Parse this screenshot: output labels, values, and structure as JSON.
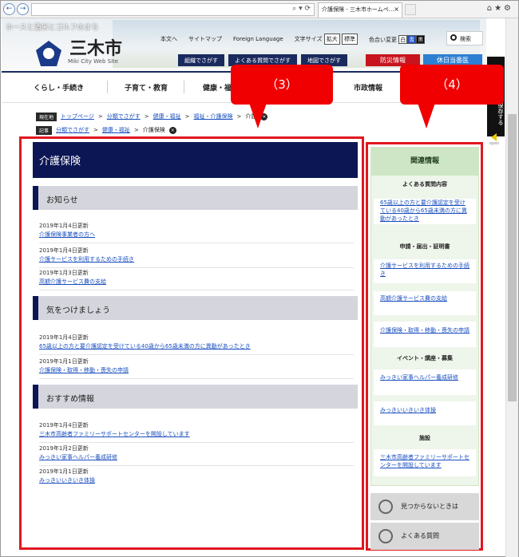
{
  "browser": {
    "tab_title": "介護保険 - 三木市ホームペ...",
    "address_icons": "⌕ ▾ ⟳"
  },
  "header": {
    "slogan": "ホースと酒米とゴルフのまち",
    "logo_text": "三木市",
    "logo_sub": "Miki City Web Site",
    "util": {
      "honbun": "本文へ",
      "sitemap": "サイトマップ",
      "foreign": "Foreign Language",
      "font_size_label": "文字サイズ",
      "font_large": "拡大",
      "font_normal": "標準",
      "color_label": "色合い変更",
      "color_white": "白",
      "color_blue": "青",
      "color_black": "黒",
      "search": "検索"
    },
    "quick": [
      "組織でさがす",
      "よくある質問でさがす",
      "地図でさがす"
    ],
    "bousai": "防災情報",
    "kyujitsu": "休日当番医"
  },
  "gnav": [
    "くらし・手続き",
    "子育て・教育",
    "健康・福",
    "市政情報"
  ],
  "side_strip": "保存する",
  "side_open": "open",
  "breadcrumb1": {
    "tag": "現在地",
    "items": [
      "トップページ",
      "分類でさがす",
      "健康・福祉",
      "福祉・介護保険"
    ],
    "current": "介護"
  },
  "breadcrumb2": {
    "tag": "記事",
    "items": [
      "分類でさがす",
      "健康・福祉"
    ],
    "current": "介護保険"
  },
  "main": {
    "title": "介護保険",
    "sections": [
      {
        "heading": "お知らせ",
        "items": [
          {
            "date": "2019年1月4日更新",
            "link": "介護保険事業者の方へ"
          },
          {
            "date": "2019年1月4日更新",
            "link": "介護サービスを利用するための手続き"
          },
          {
            "date": "2019年1月3日更新",
            "link": "高額介護サービス費の支給"
          }
        ]
      },
      {
        "heading": "気をつけましょう",
        "items": [
          {
            "date": "2019年1月4日更新",
            "link": "65歳以上の方と要介護認定を受けている40歳から65歳未満の方に異動があったとき"
          },
          {
            "date": "2019年1月1日更新",
            "link": "介護保険・取得・移動・喪失の申請"
          }
        ]
      },
      {
        "heading": "おすすめ情報",
        "items": [
          {
            "date": "2019年1月4日更新",
            "link": "三木市高齢者ファミリーサポートセンターを開設しています"
          },
          {
            "date": "2019年1月2日更新",
            "link": "みっきい家事ヘルパー養成研修"
          },
          {
            "date": "2019年1月1日更新",
            "link": "みっきいいきいき体操"
          }
        ]
      }
    ]
  },
  "related": {
    "title": "関連情報",
    "categories": [
      "よくある質問内容",
      "申請・届出・証明書",
      "イベント・講座・募集",
      "施設"
    ],
    "links": [
      "65歳以上の方と要介護認定を受けている40歳から65歳未満の方に異動があったとき",
      "介護サービスを利用するための手続き",
      "高額介護サービス費の支給",
      "介護保険・取得・移動・喪失の申請",
      "みっきい家事ヘルパー養成研修",
      "みっきいいきいき体操",
      "三木市高齢者ファミリーサポートセンターを開設しています"
    ],
    "not_found": "見つからないときは",
    "faq": "よくある質問"
  },
  "callouts": [
    "（3）",
    "（4）"
  ],
  "colors": {
    "navy": "#0c1655",
    "red_frame": "#e01820",
    "link": "#1a4fbf",
    "bousai": "#c8141e",
    "kyujitsu": "#2d7fd3"
  }
}
